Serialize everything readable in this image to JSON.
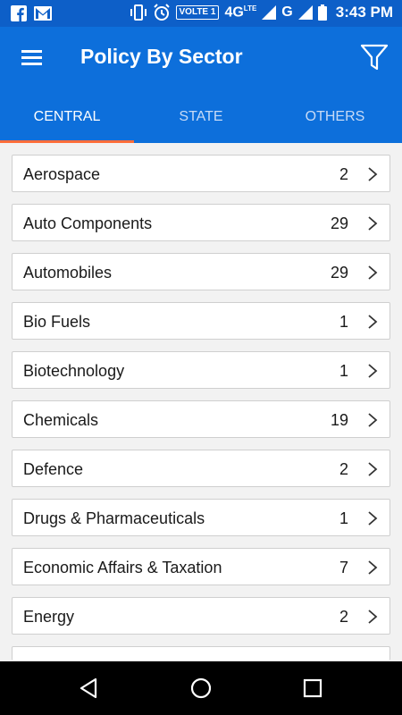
{
  "status_bar": {
    "volte": "VOLTE 1",
    "network": "4G",
    "network_sup": "LTE",
    "network2": "G",
    "time": "3:43 PM",
    "icons": [
      "facebook-icon",
      "gmail-icon",
      "vibrate-icon",
      "alarm-icon",
      "signal-icon",
      "battery-icon"
    ]
  },
  "header": {
    "title": "Policy By Sector",
    "menu_icon": "hamburger-menu-icon",
    "filter_icon": "filter-icon"
  },
  "tabs": [
    {
      "label": "CENTRAL",
      "active": true
    },
    {
      "label": "STATE",
      "active": false
    },
    {
      "label": "OTHERS",
      "active": false
    }
  ],
  "sectors": [
    {
      "label": "Aerospace",
      "count": "2"
    },
    {
      "label": "Auto Components",
      "count": "29"
    },
    {
      "label": "Automobiles",
      "count": "29"
    },
    {
      "label": "Bio Fuels",
      "count": "1"
    },
    {
      "label": "Biotechnology",
      "count": "1"
    },
    {
      "label": "Chemicals",
      "count": "19"
    },
    {
      "label": "Defence",
      "count": "2"
    },
    {
      "label": "Drugs & Pharmaceuticals",
      "count": "1"
    },
    {
      "label": "Economic Affairs & Taxation",
      "count": "7"
    },
    {
      "label": "Energy",
      "count": "2"
    }
  ],
  "colors": {
    "app_bar": "#0d6fdb",
    "status_bar": "#0d5fc8",
    "tab_indicator": "#ff6d3a",
    "background": "#f2f2f2"
  },
  "nav_bar": {
    "icons": [
      "back-icon",
      "home-icon",
      "recents-icon"
    ]
  }
}
